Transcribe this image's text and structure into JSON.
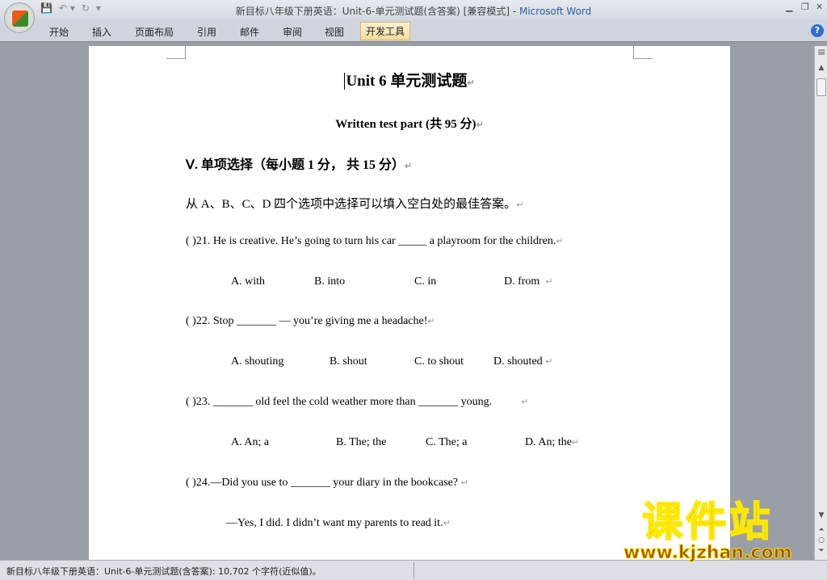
{
  "window": {
    "title_doc": "新目标八年级下册英语：Unit-6-单元测试题(含答案) [兼容模式]",
    "title_sep": " - ",
    "title_app": "Microsoft Word"
  },
  "qat": {
    "save": "💾",
    "undo": "↶ ▾",
    "redo": "↻",
    "customize": "▾"
  },
  "ribbon": {
    "tabs": [
      "开始",
      "插入",
      "页面布局",
      "引用",
      "邮件",
      "审阅",
      "视图",
      "开发工具"
    ],
    "active": "开发工具",
    "help": "?"
  },
  "document": {
    "title": "Unit 6  单元测试题",
    "subtitle": "Written test part (共 95 分)",
    "section": "Ⅴ. 单项选择（每小题 1 分， 共 15 分）",
    "instruction": "从 A、B、C、D 四个选项中选择可以填入空白处的最佳答案。",
    "q21": "(    )21. He is creative. He’s going to turn his car _____ a playroom for the children.",
    "q21_opts": [
      "A. with",
      "B. into",
      "C. in",
      "D. from"
    ],
    "q22": "(    )22. Stop _______ — you’re giving me a headache!",
    "q22_opts": [
      "A. shouting",
      "B. shout",
      "C. to shout",
      "D. shouted"
    ],
    "q23": "(    )23. _______ old feel the cold weather more than _______ young.",
    "q23_opts": [
      "A. An; a",
      "B. The; the",
      "C. The; a",
      "D. An; the"
    ],
    "q24": "(    )24.—Did you use to _______ your diary in the bookcase?",
    "q24_reply": "—Yes, I did. I didn’t want my parents to read it.",
    "mark": "↵"
  },
  "status": {
    "text": "新目标八年级下册英语：Unit-6-单元测试题(含答案): 10,702 个字符(近似值)。"
  },
  "watermark": {
    "name": "课件站",
    "url": "www.kjzhan.com"
  }
}
